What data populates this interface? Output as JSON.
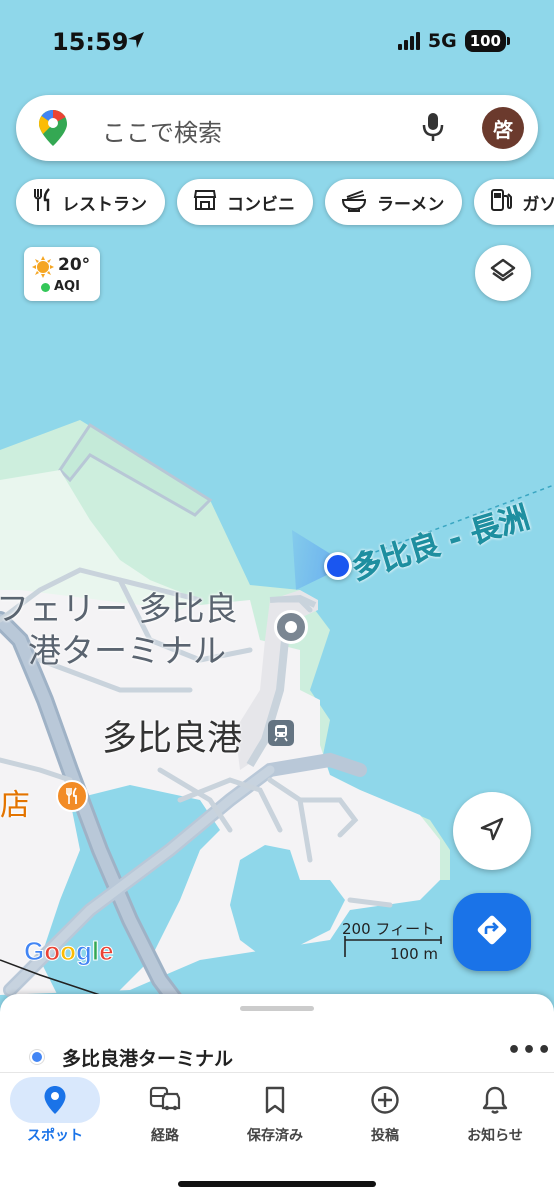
{
  "status": {
    "time": "15:59",
    "network": "5G",
    "battery": "100"
  },
  "search": {
    "placeholder": "ここで検索",
    "avatar_initial": "啓"
  },
  "chips": [
    {
      "label": "レストラン",
      "icon": "fork-knife-icon"
    },
    {
      "label": "コンビニ",
      "icon": "store-icon"
    },
    {
      "label": "ラーメン",
      "icon": "ramen-bowl-icon"
    },
    {
      "label": "ガソ",
      "icon": "gas-station-icon"
    }
  ],
  "weather": {
    "temp": "20°",
    "aqi": "AQI"
  },
  "map": {
    "route_label": "多比良 - 長洲",
    "ferry_label_line1": "フェリー 多比良",
    "ferry_label_line2": "港ターミナル",
    "station_label": "多比良港",
    "restaurant_label": "店",
    "scale_ft": "200 フィート",
    "scale_m": "100 m",
    "google": [
      "G",
      "o",
      "o",
      "g",
      "l",
      "e"
    ]
  },
  "sheet": {
    "title": "多比良港ターミナル",
    "more": "•••"
  },
  "nav": [
    {
      "label": "スポット",
      "icon": "location-pin-icon",
      "active": true
    },
    {
      "label": "経路",
      "icon": "commute-icon",
      "active": false
    },
    {
      "label": "保存済み",
      "icon": "bookmark-icon",
      "active": false
    },
    {
      "label": "投稿",
      "icon": "add-circle-icon",
      "active": false
    },
    {
      "label": "お知らせ",
      "icon": "bell-icon",
      "active": false
    }
  ],
  "colors": {
    "water": "#8fd7ea",
    "land": "#f4f3f5",
    "park": "#cdeedd",
    "accent": "#1a73e8",
    "route_label": "#1e8fa0"
  }
}
